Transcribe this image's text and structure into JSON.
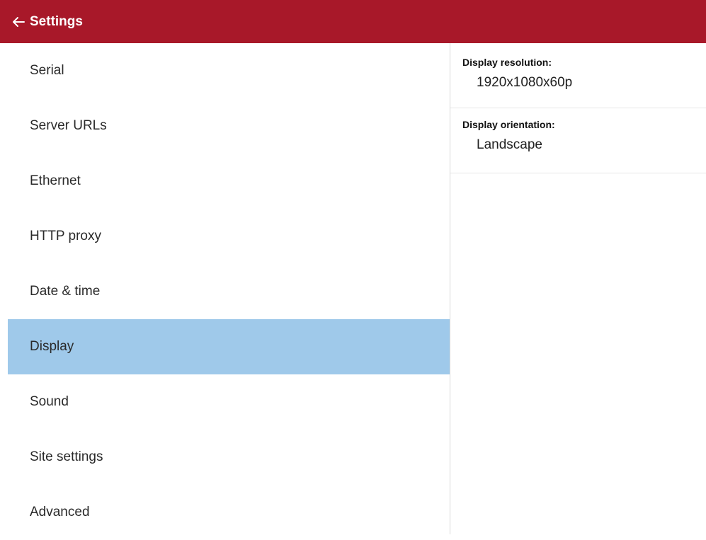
{
  "header": {
    "title": "Settings",
    "back_icon": "arrow-left-icon",
    "color": "#a81829"
  },
  "sidebar": {
    "items": [
      {
        "label": "Serial"
      },
      {
        "label": "Server URLs"
      },
      {
        "label": "Ethernet"
      },
      {
        "label": "HTTP proxy"
      },
      {
        "label": "Date & time"
      },
      {
        "label": "Display",
        "active": true
      },
      {
        "label": "Sound"
      },
      {
        "label": "Site settings"
      },
      {
        "label": "Advanced"
      }
    ],
    "active_color": "#9fc9ea"
  },
  "display": {
    "resolution": {
      "label": "Display resolution:",
      "value": "1920x1080x60p"
    },
    "orientation": {
      "label": "Display orientation:",
      "value": "Landscape"
    }
  }
}
